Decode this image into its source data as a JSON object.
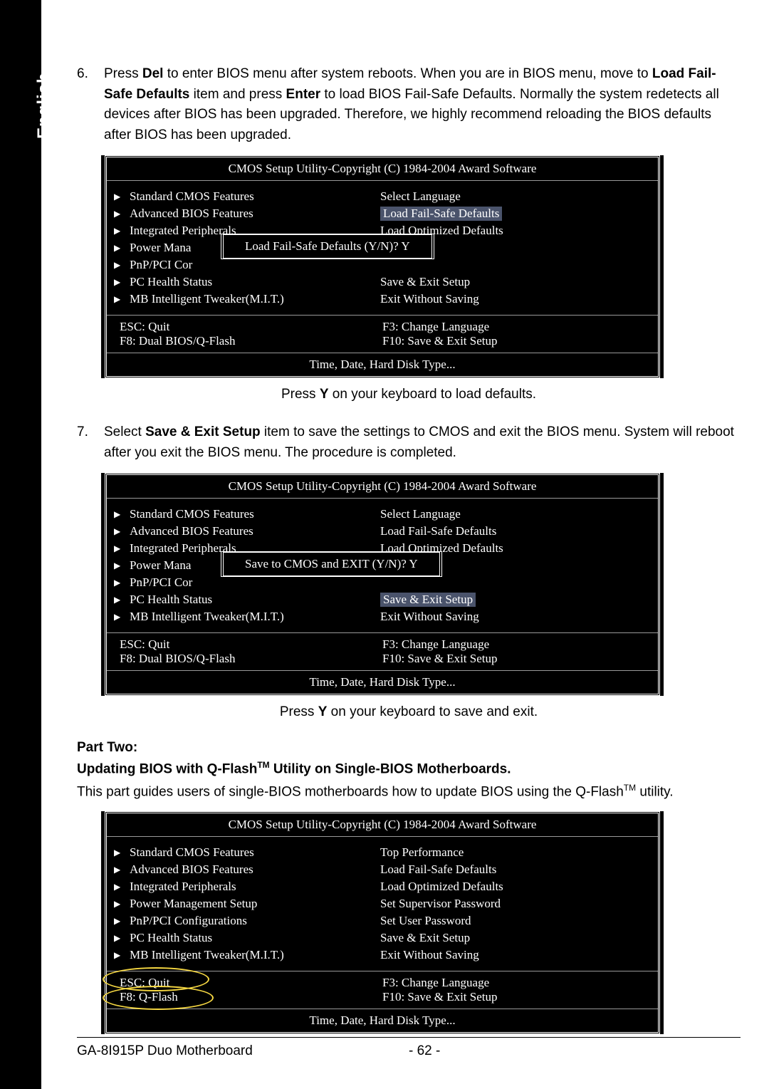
{
  "lang_tab": "English",
  "step6_num": "6.",
  "step6_text_a": "Press ",
  "step6_del": "Del",
  "step6_text_b": " to enter BIOS menu after system reboots. When you are in BIOS menu, move to ",
  "step6_bold1": "Load Fail-Safe Defaults",
  "step6_text_c": " item and press ",
  "step6_bold2": "Enter",
  "step6_text_d": " to load BIOS Fail-Safe Defaults. Normally the system redetects all devices after BIOS has been upgraded. Therefore, we highly recommend reloading the BIOS defaults after BIOS has been upgraded.",
  "caption1_a": "Press ",
  "caption1_b": "Y",
  "caption1_c": " on your keyboard to load defaults.",
  "step7_num": "7.",
  "step7_a": "Select ",
  "step7_bold": "Save & Exit Setup",
  "step7_b": " item to save the settings to CMOS and exit the BIOS menu. System will reboot after you exit the BIOS menu. The procedure is completed.",
  "caption2_a": "Press ",
  "caption2_b": "Y",
  "caption2_c": " on your keyboard to save and exit.",
  "part_two": "Part Two:",
  "heading2_a": "Updating BIOS with Q-Flash",
  "heading2_b": " Utility on Single-BIOS Motherboards.",
  "body3_a": "This part guides users of single-BIOS motherboards how to update BIOS using the Q-Flash",
  "body3_b": " utility.",
  "bios": {
    "title": "CMOS Setup Utility-Copyright (C) 1984-2004 Award Software",
    "left": [
      "Standard CMOS Features",
      "Advanced BIOS Features",
      "Integrated Peripherals",
      "Power Mana",
      "PnP/PCI Cor",
      "PC Health Status",
      "MB Intelligent Tweaker(M.I.T.)"
    ],
    "left_full": [
      "Standard CMOS Features",
      "Advanced BIOS Features",
      "Integrated Peripherals",
      "Power Management Setup",
      "PnP/PCI Configurations",
      "PC Health Status",
      "MB Intelligent Tweaker(M.I.T.)"
    ],
    "right1": [
      "Select Language",
      "Load Fail-Safe Defaults",
      "Load Optimized Defaults",
      "",
      "",
      "Save & Exit Setup",
      "Exit Without Saving"
    ],
    "right3": [
      "Top Performance",
      "Load Fail-Safe Defaults",
      "Load Optimized Defaults",
      "Set Supervisor Password",
      "Set User Password",
      "Save & Exit Setup",
      "Exit Without Saving"
    ],
    "dialog1": "Load Fail-Safe Defaults (Y/N)? Y",
    "dialog2": "Save to CMOS and EXIT (Y/N)? Y",
    "bottom_l1": "ESC: Quit",
    "bottom_r1": "F3: Change Language",
    "bottom_l2a": "F8: Dual BIOS/Q-Flash",
    "bottom_l2b": "F8: Q-Flash",
    "bottom_r2": "F10: Save & Exit Setup",
    "help": "Time, Date, Hard Disk Type..."
  },
  "footer_model": "GA-8I915P Duo Motherboard",
  "footer_page": "- 62 -"
}
